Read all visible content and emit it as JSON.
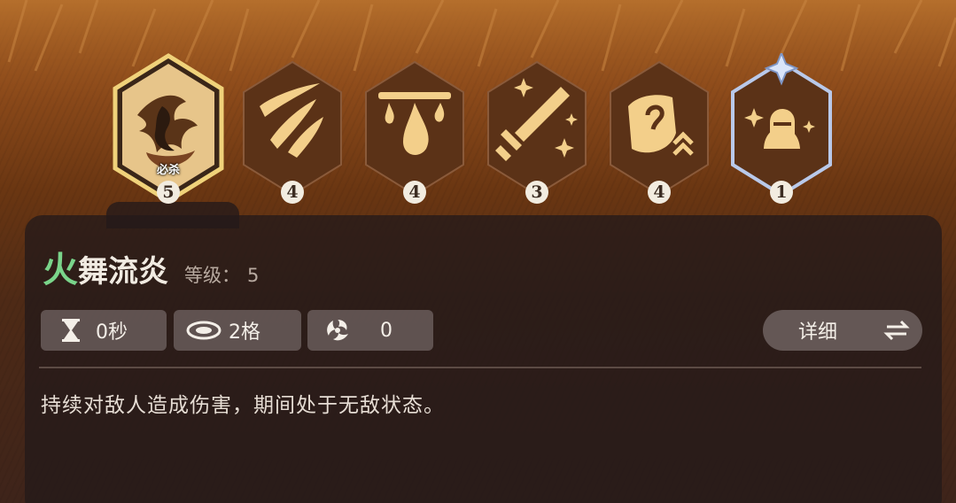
{
  "skills": [
    {
      "level": "5",
      "tag": "必杀",
      "icon": "flame-dancer-icon",
      "selected": true
    },
    {
      "level": "4",
      "icon": "slash-streaks-icon"
    },
    {
      "level": "4",
      "icon": "drip-drops-icon"
    },
    {
      "level": "3",
      "icon": "sword-strike-icon"
    },
    {
      "level": "4",
      "icon": "shield-upgrade-icon"
    },
    {
      "level": "1",
      "icon": "knight-helmet-icon",
      "awakened": true
    }
  ],
  "info": {
    "name_first": "火",
    "name_rest": "舞流炎",
    "level_label": "等级：",
    "level_value": "5"
  },
  "stats": {
    "cooldown": "0秒",
    "range": "2格",
    "energy": "0"
  },
  "detail_button": {
    "label": "详细"
  },
  "description": "持续对敌人造成伤害，期间处于无敌状态。",
  "colors": {
    "selected_border": "#f0d27a",
    "icon_gold": "#f3cf8a",
    "awakened_border": "#b9c9ea",
    "name_accent": "#7ad48a"
  }
}
